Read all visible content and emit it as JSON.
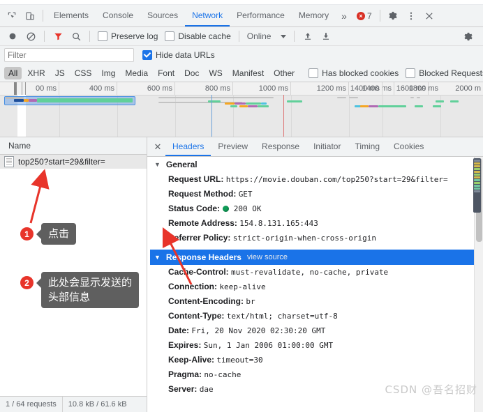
{
  "window": {
    "error_count": "7"
  },
  "main_tabs": {
    "items": [
      {
        "label": "Elements",
        "active": false
      },
      {
        "label": "Console",
        "active": false
      },
      {
        "label": "Sources",
        "active": false
      },
      {
        "label": "Network",
        "active": true
      },
      {
        "label": "Performance",
        "active": false
      },
      {
        "label": "Memory",
        "active": false
      }
    ],
    "more_label": "»",
    "settings_icon": "gear-icon",
    "menu_icon": "kebab-menu-icon",
    "close_icon": "close-icon",
    "inspect_icon": "inspect-element-icon",
    "device_icon": "device-toolbar-icon"
  },
  "network_toolbar": {
    "record_icon": "record-circle-icon",
    "clear_icon": "clear-no-entry-icon",
    "filter_icon": "funnel-filter-icon",
    "search_icon": "search-magnifier-icon",
    "preserve_log": {
      "label": "Preserve log",
      "checked": false
    },
    "disable_cache": {
      "label": "Disable cache",
      "checked": false
    },
    "throttling": "Online",
    "import_icon": "import-har-up-arrow-icon",
    "export_icon": "export-har-down-arrow-icon",
    "settings_icon": "network-settings-gear-icon"
  },
  "filter_row": {
    "placeholder": "Filter",
    "value": "",
    "hide_data_urls": {
      "label": "Hide data URLs",
      "checked": true
    }
  },
  "type_filters": {
    "items": [
      {
        "label": "All",
        "active": true
      },
      {
        "label": "XHR",
        "active": false
      },
      {
        "label": "JS",
        "active": false
      },
      {
        "label": "CSS",
        "active": false
      },
      {
        "label": "Img",
        "active": false
      },
      {
        "label": "Media",
        "active": false
      },
      {
        "label": "Font",
        "active": false
      },
      {
        "label": "Doc",
        "active": false
      },
      {
        "label": "WS",
        "active": false
      },
      {
        "label": "Manifest",
        "active": false
      },
      {
        "label": "Other",
        "active": false
      }
    ],
    "has_blocked_cookies": {
      "label": "Has blocked cookies",
      "checked": false
    },
    "blocked_requests": {
      "label": "Blocked Requests",
      "checked": false
    }
  },
  "overview": {
    "ticks": [
      "00 ms",
      "400 ms",
      "600 ms",
      "800 ms",
      "1000 ms",
      "1200 ms",
      "1400 ms",
      "1600 ms",
      "1800 ms",
      "2000 m"
    ],
    "dom_content_loaded_color": "#6aa0d8",
    "load_event_color": "#dd7777"
  },
  "requests_panel": {
    "column_header": "Name",
    "rows": [
      {
        "name": "top250?start=29&filter=",
        "icon": "document-file-icon",
        "selected": true
      }
    ],
    "status_bar": {
      "requests": "1 / 64 requests",
      "transferred": "10.8 kB / 61.6 kB"
    }
  },
  "detail_panel": {
    "close_label": "✕",
    "tabs": [
      {
        "label": "Headers",
        "active": true
      },
      {
        "label": "Preview",
        "active": false
      },
      {
        "label": "Response",
        "active": false
      },
      {
        "label": "Initiator",
        "active": false
      },
      {
        "label": "Timing",
        "active": false
      },
      {
        "label": "Cookies",
        "active": false
      }
    ],
    "general": {
      "title": "General",
      "expanded": true,
      "rows": [
        {
          "key": "Request URL:",
          "value": "https://movie.douban.com/top250?start=29&filter="
        },
        {
          "key": "Request Method:",
          "value": "GET"
        },
        {
          "key": "Status Code:",
          "value": "200 OK",
          "has_status_dot": true
        },
        {
          "key": "Remote Address:",
          "value": "154.8.131.165:443"
        },
        {
          "key": "Referrer Policy:",
          "value": "strict-origin-when-cross-origin"
        }
      ]
    },
    "response_headers": {
      "title": "Response Headers",
      "view_source": "view source",
      "expanded": true,
      "selected": true,
      "rows": [
        {
          "key": "Cache-Control:",
          "value": "must-revalidate, no-cache, private"
        },
        {
          "key": "Connection:",
          "value": "keep-alive"
        },
        {
          "key": "Content-Encoding:",
          "value": "br"
        },
        {
          "key": "Content-Type:",
          "value": "text/html; charset=utf-8"
        },
        {
          "key": "Date:",
          "value": "Fri, 20 Nov 2020 02:30:20 GMT"
        },
        {
          "key": "Expires:",
          "value": "Sun, 1 Jan 2006 01:00:00 GMT"
        },
        {
          "key": "Keep-Alive:",
          "value": "timeout=30"
        },
        {
          "key": "Pragma:",
          "value": "no-cache"
        },
        {
          "key": "Server:",
          "value": "dae"
        }
      ]
    }
  },
  "annotations": {
    "items": [
      {
        "number": "1",
        "text": "点击"
      },
      {
        "number": "2",
        "text": "此处会显示发送的\n头部信息"
      }
    ],
    "arrow_color": "#e8342a"
  },
  "watermark": "CSDN @吾名招财"
}
